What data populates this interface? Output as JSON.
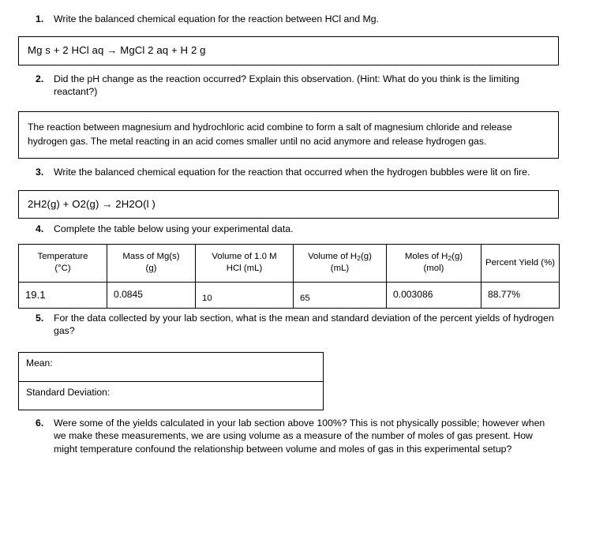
{
  "document": {
    "type": "chemistry-lab-worksheet"
  },
  "questions": [
    {
      "number": "1.",
      "text": "Write the balanced chemical equation for the reaction between HCl and Mg."
    },
    {
      "number": "2.",
      "text": "Did the pH change as the reaction occurred?  Explain this observation.  (Hint: What do you think is the limiting reactant?)"
    },
    {
      "number": "3.",
      "text": "Write the balanced chemical equation for the reaction that occurred when the hydrogen bubbles were lit on fire."
    },
    {
      "number": "4.",
      "text": "Complete the table below using your experimental data."
    },
    {
      "number": "5.",
      "text": "For the data collected by your lab section, what is the mean and standard deviation of the percent yields of hydrogen gas?"
    },
    {
      "number": "6.",
      "text": "Were some of the yields calculated in your lab section above 100%?  This is not physically possible; however when we make these measurements, we are using volume as a measure of the number of moles of gas present.  How might temperature confound the relationship between volume and moles of gas in this experimental setup?"
    }
  ],
  "answers": {
    "equation_1": "Mg s + 2 HCl aq → MgCl 2 aq + H 2 g",
    "explanation_2": "The reaction between magnesium and hydrochloric acid combine to form a salt of magnesium chloride and release hydrogen gas. The metal reacting in an acid comes smaller until no acid anymore and release hydrogen gas.",
    "equation_3": "2H2(g) + O2(g) → 2H2O(l )"
  },
  "data_table": {
    "headers": [
      {
        "line1": "Temperature",
        "line2": "(°C)"
      },
      {
        "line1": "Mass of Mg(s)",
        "line2": "(g)"
      },
      {
        "line1": "Volume of 1.0 M",
        "line2": "HCl (mL)"
      },
      {
        "line1_pre": "Volume of H",
        "line1_sub": "2",
        "line1_post": "(g)",
        "line2": "(mL)"
      },
      {
        "line1_pre": "Moles of H",
        "line1_sub": "2",
        "line1_post": "(g)",
        "line2": "(mol)"
      },
      {
        "line1": "Percent Yield (%)",
        "line2": ""
      }
    ],
    "row": {
      "temperature": "19.1",
      "mass_mg": "0.0845",
      "volume_hcl": "10",
      "volume_h2": "65",
      "moles_h2": "0.003086",
      "percent_yield": "88.77%"
    }
  },
  "stats_box": {
    "mean_label": "Mean:",
    "std_dev_label": "Standard Deviation:"
  }
}
